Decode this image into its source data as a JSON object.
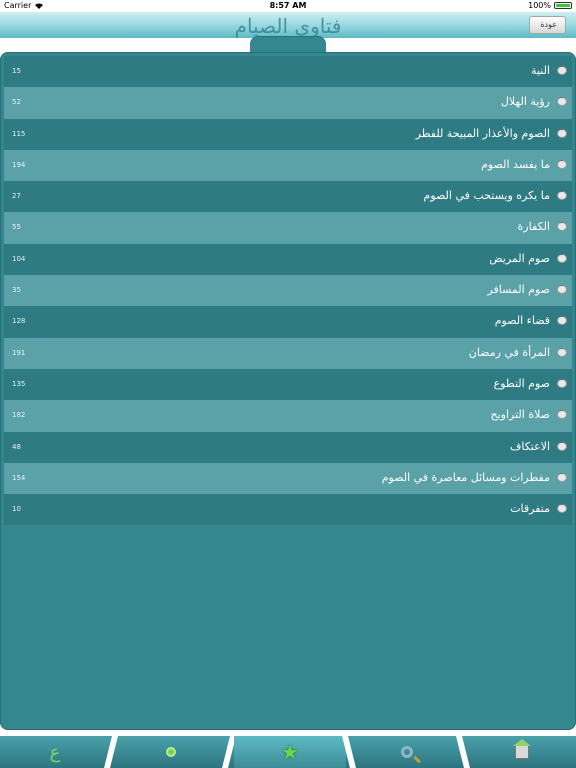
{
  "status_bar": {
    "carrier": "Carrier",
    "time": "8:57 AM",
    "battery": "100%"
  },
  "header": {
    "title": "فتاوى الصيام",
    "back_label": "عودة"
  },
  "items": [
    {
      "label": "النية",
      "count": "15"
    },
    {
      "label": "رؤية الهلال",
      "count": "52"
    },
    {
      "label": "الصوم والأعذار المبيحة للفطر",
      "count": "115"
    },
    {
      "label": "ما يفسد الصوم",
      "count": "194"
    },
    {
      "label": "ما يكره ويستحب في الصوم",
      "count": "27"
    },
    {
      "label": "الكفارة",
      "count": "55"
    },
    {
      "label": "صوم المريض",
      "count": "104"
    },
    {
      "label": "صوم المسافر",
      "count": "35"
    },
    {
      "label": "قضاء الصوم",
      "count": "128"
    },
    {
      "label": "المرأة في رمضان",
      "count": "191"
    },
    {
      "label": "صوم التطوع",
      "count": "135"
    },
    {
      "label": "صلاة التراويح",
      "count": "182"
    },
    {
      "label": "الاعتكاف",
      "count": "48"
    },
    {
      "label": "مفطرات ومسائل معاصرة في الصوم",
      "count": "154"
    },
    {
      "label": "متفرقات",
      "count": "10"
    }
  ],
  "tabbar": {
    "icons": [
      "ain-letter-icon",
      "disc-icon",
      "star-icon",
      "search-icon",
      "home-icon"
    ],
    "selected_index": 2
  },
  "colors": {
    "panel": "#34878f",
    "row_dark": "#2f7b84",
    "row_light": "#5aa2a8",
    "header_light": "#cfeff2",
    "accent_green": "#6cd74a"
  }
}
